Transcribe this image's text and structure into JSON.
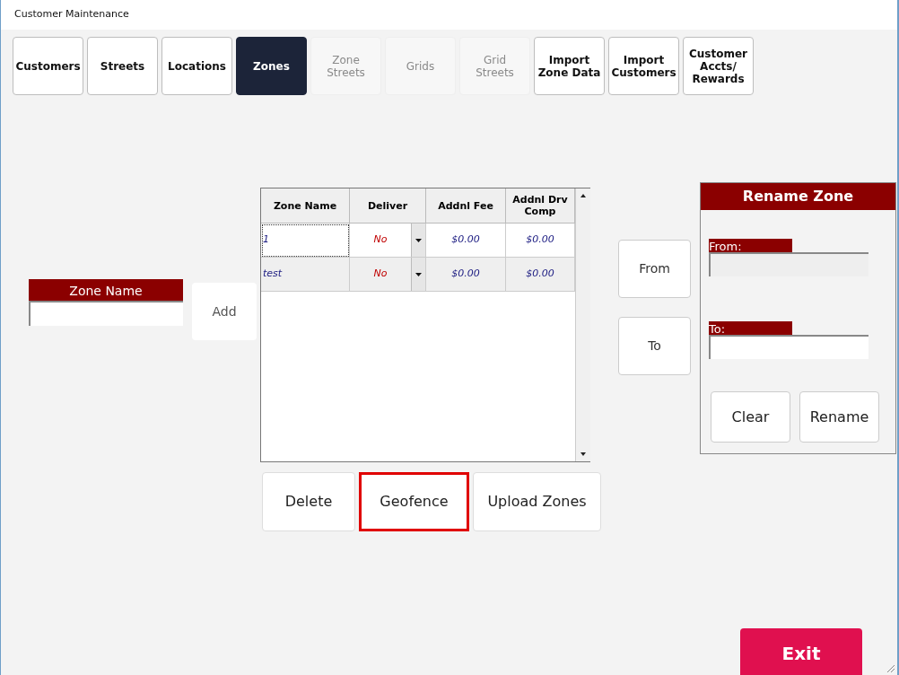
{
  "window": {
    "title": "Customer Maintenance"
  },
  "tabs": [
    {
      "label": "Customers",
      "selected": false,
      "disabled": false
    },
    {
      "label": "Streets",
      "selected": false,
      "disabled": false
    },
    {
      "label": "Locations",
      "selected": false,
      "disabled": false
    },
    {
      "label": "Zones",
      "selected": true,
      "disabled": false
    },
    {
      "label": "Zone\nStreets",
      "selected": false,
      "disabled": true
    },
    {
      "label": "Grids",
      "selected": false,
      "disabled": true
    },
    {
      "label": "Grid\nStreets",
      "selected": false,
      "disabled": true
    },
    {
      "label": "Import\nZone Data",
      "selected": false,
      "disabled": false
    },
    {
      "label": "Import\nCustomers",
      "selected": false,
      "disabled": false
    },
    {
      "label": "Customer\nAccts/\nRewards",
      "selected": false,
      "disabled": false
    }
  ],
  "zone_name": {
    "label": "Zone Name",
    "add_button": "Add"
  },
  "grid": {
    "columns": [
      "Zone Name",
      "Deliver",
      "Addnl Fee",
      "Addnl Drv\nComp"
    ],
    "rows": [
      {
        "zone_name": "1",
        "deliver": "No",
        "addnl_fee": "$0.00",
        "addnl_drv_comp": "$0.00",
        "focused": true
      },
      {
        "zone_name": "test",
        "deliver": "No",
        "addnl_fee": "$0.00",
        "addnl_drv_comp": "$0.00",
        "focused": false
      }
    ]
  },
  "grid_buttons": [
    {
      "label": "Delete",
      "highlighted": false
    },
    {
      "label": "Geofence",
      "highlighted": true
    },
    {
      "label": "Upload Zones",
      "highlighted": false
    }
  ],
  "from_to_buttons": [
    "From",
    "To"
  ],
  "rename_zone": {
    "title": "Rename Zone",
    "from_label": "From:",
    "to_label": "To:",
    "buttons": [
      "Clear",
      "Rename"
    ]
  },
  "exit_button": "Exit"
}
